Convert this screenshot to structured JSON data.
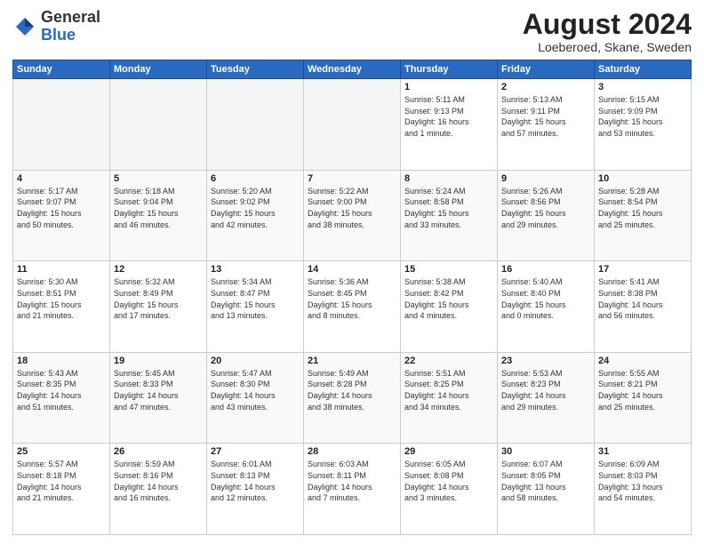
{
  "header": {
    "logo_general": "General",
    "logo_blue": "Blue",
    "title": "August 2024",
    "location": "Loeberoed, Skane, Sweden"
  },
  "weekdays": [
    "Sunday",
    "Monday",
    "Tuesday",
    "Wednesday",
    "Thursday",
    "Friday",
    "Saturday"
  ],
  "weeks": [
    [
      {
        "day": "",
        "info": ""
      },
      {
        "day": "",
        "info": ""
      },
      {
        "day": "",
        "info": ""
      },
      {
        "day": "",
        "info": ""
      },
      {
        "day": "1",
        "info": "Sunrise: 5:11 AM\nSunset: 9:13 PM\nDaylight: 16 hours\nand 1 minute."
      },
      {
        "day": "2",
        "info": "Sunrise: 5:13 AM\nSunset: 9:11 PM\nDaylight: 15 hours\nand 57 minutes."
      },
      {
        "day": "3",
        "info": "Sunrise: 5:15 AM\nSunset: 9:09 PM\nDaylight: 15 hours\nand 53 minutes."
      }
    ],
    [
      {
        "day": "4",
        "info": "Sunrise: 5:17 AM\nSunset: 9:07 PM\nDaylight: 15 hours\nand 50 minutes."
      },
      {
        "day": "5",
        "info": "Sunrise: 5:18 AM\nSunset: 9:04 PM\nDaylight: 15 hours\nand 46 minutes."
      },
      {
        "day": "6",
        "info": "Sunrise: 5:20 AM\nSunset: 9:02 PM\nDaylight: 15 hours\nand 42 minutes."
      },
      {
        "day": "7",
        "info": "Sunrise: 5:22 AM\nSunset: 9:00 PM\nDaylight: 15 hours\nand 38 minutes."
      },
      {
        "day": "8",
        "info": "Sunrise: 5:24 AM\nSunset: 8:58 PM\nDaylight: 15 hours\nand 33 minutes."
      },
      {
        "day": "9",
        "info": "Sunrise: 5:26 AM\nSunset: 8:56 PM\nDaylight: 15 hours\nand 29 minutes."
      },
      {
        "day": "10",
        "info": "Sunrise: 5:28 AM\nSunset: 8:54 PM\nDaylight: 15 hours\nand 25 minutes."
      }
    ],
    [
      {
        "day": "11",
        "info": "Sunrise: 5:30 AM\nSunset: 8:51 PM\nDaylight: 15 hours\nand 21 minutes."
      },
      {
        "day": "12",
        "info": "Sunrise: 5:32 AM\nSunset: 8:49 PM\nDaylight: 15 hours\nand 17 minutes."
      },
      {
        "day": "13",
        "info": "Sunrise: 5:34 AM\nSunset: 8:47 PM\nDaylight: 15 hours\nand 13 minutes."
      },
      {
        "day": "14",
        "info": "Sunrise: 5:36 AM\nSunset: 8:45 PM\nDaylight: 15 hours\nand 8 minutes."
      },
      {
        "day": "15",
        "info": "Sunrise: 5:38 AM\nSunset: 8:42 PM\nDaylight: 15 hours\nand 4 minutes."
      },
      {
        "day": "16",
        "info": "Sunrise: 5:40 AM\nSunset: 8:40 PM\nDaylight: 15 hours\nand 0 minutes."
      },
      {
        "day": "17",
        "info": "Sunrise: 5:41 AM\nSunset: 8:38 PM\nDaylight: 14 hours\nand 56 minutes."
      }
    ],
    [
      {
        "day": "18",
        "info": "Sunrise: 5:43 AM\nSunset: 8:35 PM\nDaylight: 14 hours\nand 51 minutes."
      },
      {
        "day": "19",
        "info": "Sunrise: 5:45 AM\nSunset: 8:33 PM\nDaylight: 14 hours\nand 47 minutes."
      },
      {
        "day": "20",
        "info": "Sunrise: 5:47 AM\nSunset: 8:30 PM\nDaylight: 14 hours\nand 43 minutes."
      },
      {
        "day": "21",
        "info": "Sunrise: 5:49 AM\nSunset: 8:28 PM\nDaylight: 14 hours\nand 38 minutes."
      },
      {
        "day": "22",
        "info": "Sunrise: 5:51 AM\nSunset: 8:25 PM\nDaylight: 14 hours\nand 34 minutes."
      },
      {
        "day": "23",
        "info": "Sunrise: 5:53 AM\nSunset: 8:23 PM\nDaylight: 14 hours\nand 29 minutes."
      },
      {
        "day": "24",
        "info": "Sunrise: 5:55 AM\nSunset: 8:21 PM\nDaylight: 14 hours\nand 25 minutes."
      }
    ],
    [
      {
        "day": "25",
        "info": "Sunrise: 5:57 AM\nSunset: 8:18 PM\nDaylight: 14 hours\nand 21 minutes."
      },
      {
        "day": "26",
        "info": "Sunrise: 5:59 AM\nSunset: 8:16 PM\nDaylight: 14 hours\nand 16 minutes."
      },
      {
        "day": "27",
        "info": "Sunrise: 6:01 AM\nSunset: 8:13 PM\nDaylight: 14 hours\nand 12 minutes."
      },
      {
        "day": "28",
        "info": "Sunrise: 6:03 AM\nSunset: 8:11 PM\nDaylight: 14 hours\nand 7 minutes."
      },
      {
        "day": "29",
        "info": "Sunrise: 6:05 AM\nSunset: 8:08 PM\nDaylight: 14 hours\nand 3 minutes."
      },
      {
        "day": "30",
        "info": "Sunrise: 6:07 AM\nSunset: 8:05 PM\nDaylight: 13 hours\nand 58 minutes."
      },
      {
        "day": "31",
        "info": "Sunrise: 6:09 AM\nSunset: 8:03 PM\nDaylight: 13 hours\nand 54 minutes."
      }
    ]
  ]
}
